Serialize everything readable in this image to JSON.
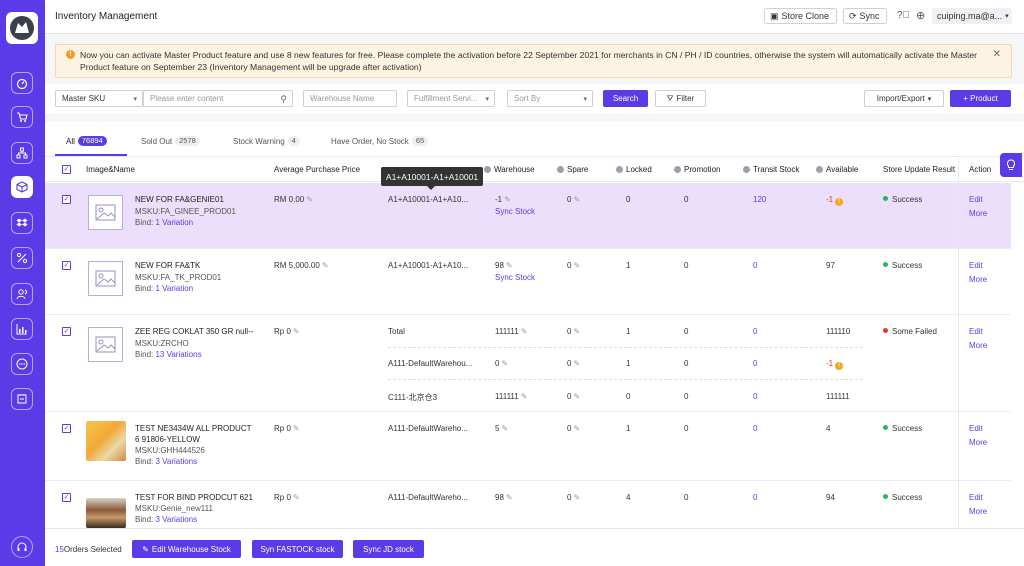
{
  "colors": {
    "brand": "#5b3be8",
    "success": "#2db55d",
    "failed": "#e0392b",
    "warning": "#f5a623",
    "highlight_row": "#ecdffb"
  },
  "sidebar": {
    "items": [
      {
        "icon": "dashboard-icon"
      },
      {
        "icon": "cart-icon"
      },
      {
        "icon": "sitemap-icon"
      },
      {
        "icon": "box-icon",
        "active": true
      },
      {
        "icon": "dropbox-icon"
      },
      {
        "icon": "percent-icon"
      },
      {
        "icon": "users-icon"
      },
      {
        "icon": "bar-chart-icon"
      },
      {
        "icon": "chat-icon"
      },
      {
        "icon": "plus-square-icon"
      },
      {
        "icon": "headset-icon"
      }
    ]
  },
  "header": {
    "title": "Inventory Management",
    "store_clone": "Store Clone",
    "sync": "Sync",
    "user": "cuiping.ma@a..."
  },
  "notice": {
    "text": "Now you can activate Master Product feature and use 8 new features for free. Please complete the activation before 22 September 2021 for merchants in CN / PH / ID countries, otherwise the system will automatically activate the Master Product feature on September 23 (Inventory Management will be upgrade after activation)"
  },
  "filters": {
    "master_sku": "Master SKU",
    "search_placeholder": "Please enter content",
    "warehouse_placeholder": "Warehouse Name",
    "fulfillment_placeholder": "Fulfillment Servi...",
    "sort_placeholder": "Sort By",
    "search_btn": "Search",
    "filter_btn": "Filter",
    "import_export": "Import/Export",
    "add_product": "+ Product"
  },
  "tabs": [
    {
      "label": "All",
      "count": "76894"
    },
    {
      "label": "Sold Out",
      "count": "2578"
    },
    {
      "label": "Stock Warning",
      "count": "4"
    },
    {
      "label": "Have Order, No Stock",
      "count": "65"
    }
  ],
  "columns": {
    "image_name": "Image&Name",
    "avg_price": "Average Purchase Price",
    "warehouse": "Warehouse",
    "spare": "Spare",
    "locked": "Locked",
    "promotion": "Promotion",
    "transit": "Transit Stock",
    "available": "Available",
    "store_update": "Store Update Result",
    "action": "Action"
  },
  "tooltip": "A1+A10001-A1+A10001",
  "rows": [
    {
      "name": "NEW FOR FA&GENIE01",
      "msku": "MSKU:FA_GINEE_PROD01",
      "bind_label": "Bind:",
      "bind": "1 Variation",
      "price": "RM 0.00",
      "wh_name": "A1+A10001-A1+A10...",
      "warehouse": "-1",
      "sync": "Sync Stock",
      "spare": "0",
      "locked": "0",
      "promotion": "0",
      "transit": "120",
      "available": "-1",
      "result": "Success",
      "edit": "Edit",
      "more": "More"
    },
    {
      "name": "NEW FOR FA&TK",
      "msku": "MSKU:FA_TK_PROD01",
      "bind_label": "Bind:",
      "bind": "1 Variation",
      "price": "RM 5,000.00",
      "wh_name": "A1+A10001-A1+A10...",
      "warehouse": "98",
      "sync": "Sync Stock",
      "spare": "0",
      "locked": "1",
      "promotion": "0",
      "transit": "0",
      "available": "97",
      "result": "Success",
      "edit": "Edit",
      "more": "More"
    },
    {
      "name": "ZEE REG COKLAT 350 GR null--",
      "msku": "MSKU:ZRCHO",
      "bind_label": "Bind:",
      "bind": "13 Variations",
      "price": "Rp 0",
      "result": "Some Failed",
      "edit": "Edit",
      "more": "More",
      "sub": [
        {
          "wh_name": "Total",
          "warehouse": "111111",
          "spare": "0",
          "locked": "1",
          "promotion": "0",
          "transit": "0",
          "available": "111110"
        },
        {
          "wh_name": "A111-DefaultWarehou...",
          "warehouse": "0",
          "spare": "0",
          "locked": "1",
          "promotion": "0",
          "transit": "0",
          "available": "-1"
        },
        {
          "wh_name": "C111-北京仓3",
          "warehouse": "111111",
          "spare": "0",
          "locked": "0",
          "promotion": "0",
          "transit": "0",
          "available": "111111"
        }
      ]
    },
    {
      "name": "TEST NE3434W ALL PRODUCT",
      "name2": "6 91806-YELLOW",
      "msku": "MSKU:GHH444526",
      "bind_label": "Bind:",
      "bind": "3 Variations",
      "price": "Rp 0",
      "wh_name": "A111-DefaultWareho...",
      "warehouse": "5",
      "spare": "0",
      "locked": "1",
      "promotion": "0",
      "transit": "0",
      "available": "4",
      "result": "Success",
      "edit": "Edit",
      "more": "More"
    },
    {
      "name": "TEST FOR BIND PRODCUT 621",
      "msku": "MSKU:Genie_new111",
      "bind_label": "Bind:",
      "bind": "3 Variations",
      "price": "Rp 0",
      "wh_name": "A111-DefaultWareho...",
      "warehouse": "98",
      "spare": "0",
      "locked": "4",
      "promotion": "0",
      "transit": "0",
      "available": "94",
      "result": "Success",
      "edit": "Edit",
      "more": "More"
    }
  ],
  "footer": {
    "count": "15",
    "selected": "Orders Selected",
    "edit_wh": "Edit Warehouse Stock",
    "syn_fastock": "Syn FASTOCK stock",
    "sync_jd": "Sync JD stock"
  }
}
